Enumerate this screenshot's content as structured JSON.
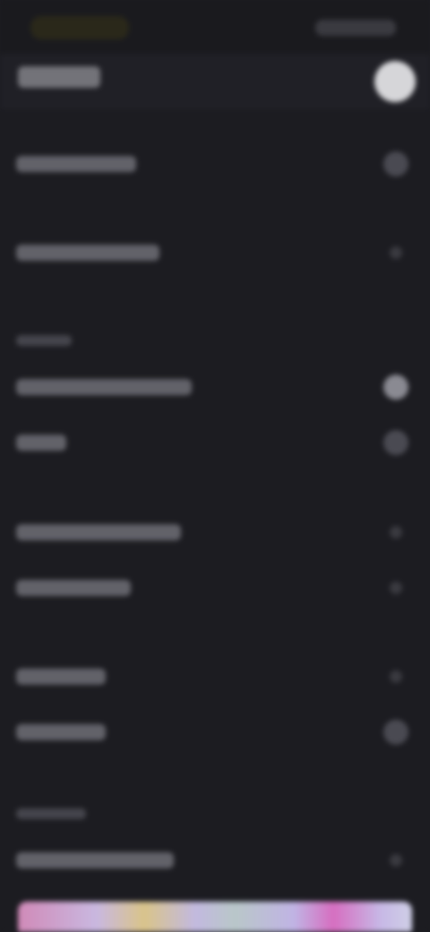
{
  "status_bar": {
    "left_indicator": "",
    "right_indicator": ""
  },
  "header": {
    "title": "",
    "avatar_icon": "user-avatar-icon"
  },
  "rows": [
    {
      "label": "",
      "icon": "chevron-icon"
    },
    {
      "label": "",
      "icon": "chevron-icon"
    },
    {
      "label": "",
      "icon": "toggle-icon"
    },
    {
      "label": "",
      "icon": "toggle-icon"
    },
    {
      "label": "",
      "icon": "chevron-icon"
    },
    {
      "label": "",
      "icon": "chevron-icon"
    },
    {
      "label": "",
      "icon": "chevron-icon"
    },
    {
      "label": "",
      "icon": "toggle-icon"
    },
    {
      "label": "",
      "icon": "chevron-icon"
    }
  ],
  "sections": [
    {
      "title": ""
    },
    {
      "title": ""
    }
  ],
  "colors": {
    "background": "#1c1c21",
    "header": "#202026",
    "bottom_gradient_pink": "#d66ec0",
    "bottom_gradient_lavender": "#c7b8e6"
  }
}
